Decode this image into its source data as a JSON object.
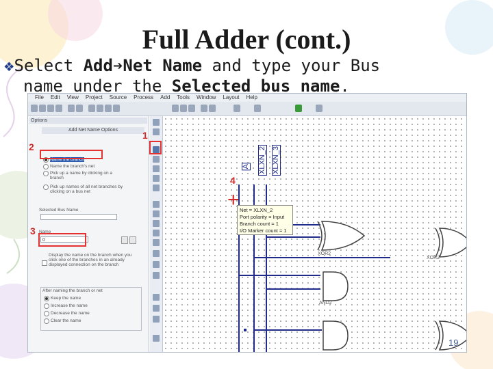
{
  "slide": {
    "title": "Full Adder (cont.)",
    "bullet": {
      "line1_pre": "Select ",
      "line1_bold1": "Add",
      "line1_bold2": "Net Name",
      "line1_post": " and type your Bus",
      "line2_pre": "name under the ",
      "line2_bold": "Selected bus name",
      "line2_post": "."
    },
    "page_number": "19",
    "bullet_icon": "diamond-bullet-icon",
    "arrow_icon": "right-arrow-icon"
  },
  "app": {
    "menu": [
      "File",
      "Edit",
      "View",
      "Project",
      "Source",
      "Process",
      "Add",
      "Tools",
      "Window",
      "Layout",
      "Help"
    ],
    "options_panel": {
      "header": "Options",
      "sub_header": "Add Net Name Options",
      "radio_options": [
        {
          "label": "Name the branch",
          "selected": true
        },
        {
          "label": "Name the branch's net",
          "selected": false
        },
        {
          "label": "Pick up a name by clicking on a branch",
          "selected": false
        },
        {
          "label": "Pick up names of all net branches by clicking on a bus net",
          "selected": false
        }
      ],
      "selected_bus_label": "Selected Bus Name",
      "name_label": "Name",
      "name_value": "0",
      "display_option": "Display the name on the branch when you click one of the branches in an already displayed connection on the branch",
      "after_naming_label": "After naming the branch or net",
      "after_options": [
        {
          "label": "Keep the name",
          "selected": true
        },
        {
          "label": "Increase the name",
          "selected": false
        },
        {
          "label": "Decrease the name",
          "selected": false
        },
        {
          "label": "Clear the name",
          "selected": false
        }
      ]
    },
    "canvas": {
      "net_labels": [
        "A",
        "XLXN_2",
        "XLXN_3"
      ],
      "tooltip": [
        "Net = XLXN_2",
        "Port polarity = Input",
        "Branch count = 1",
        "I/O Marker count = 1"
      ],
      "gate_labels": [
        "XOR2",
        "XOR2",
        "AND2"
      ]
    }
  },
  "annotations": {
    "step1": "1",
    "step2": "2",
    "step3": "3",
    "step4": "4",
    "cursor_mark": "+"
  },
  "colors": {
    "annotation_red": "#e53030",
    "wire_blue": "#1f2a8a"
  }
}
